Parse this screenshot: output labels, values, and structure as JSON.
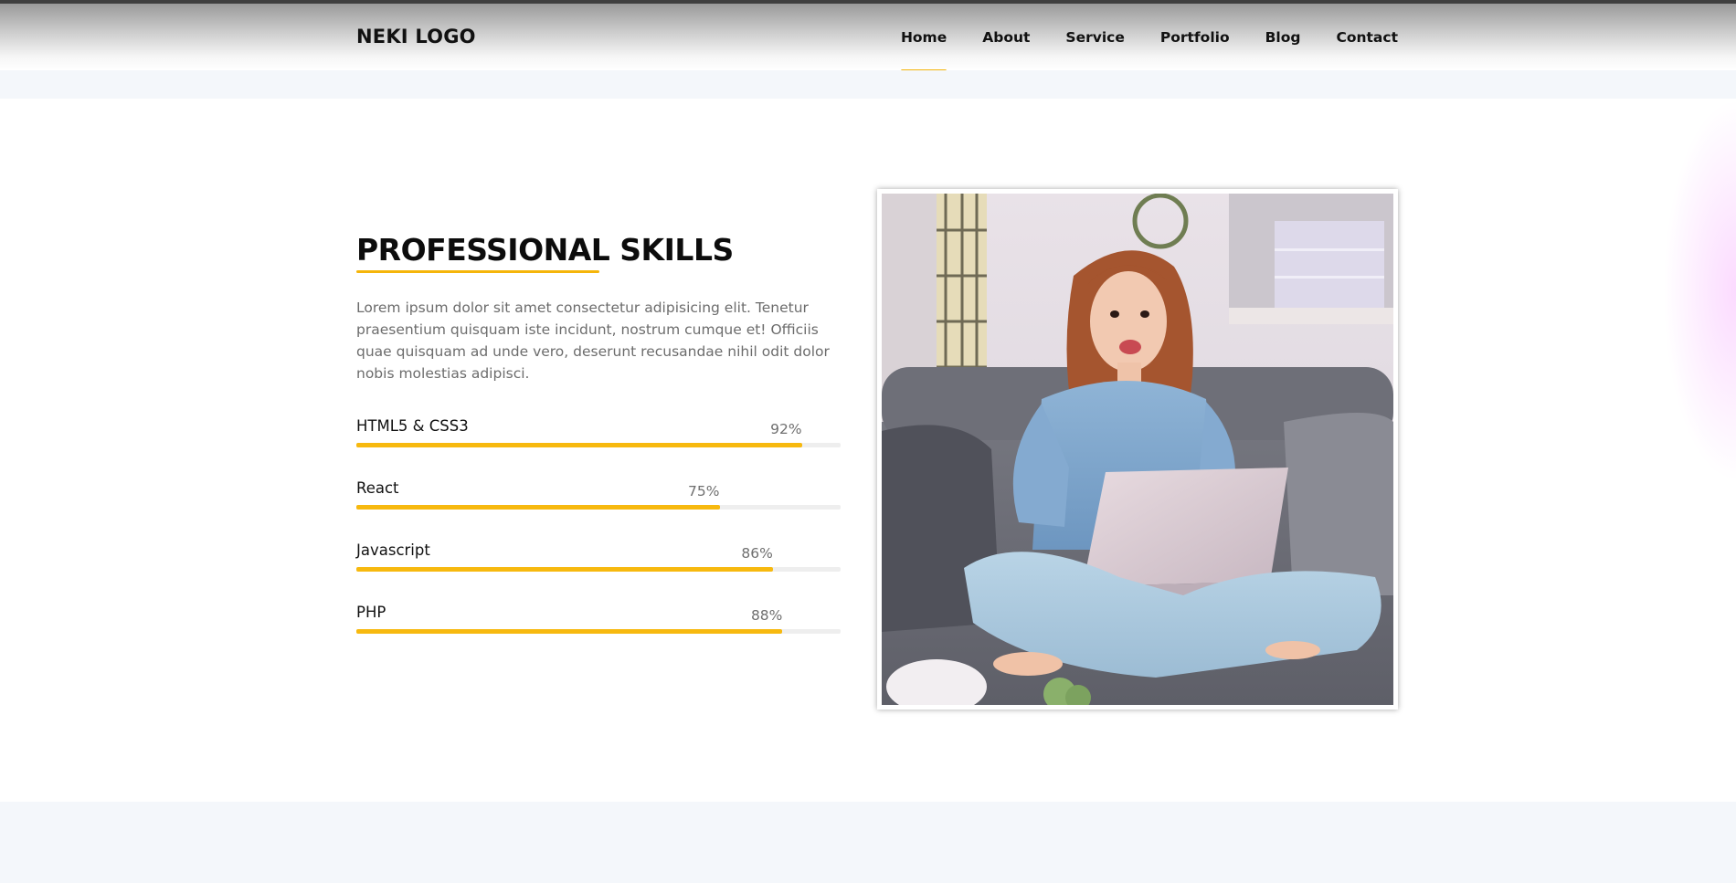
{
  "header": {
    "logo": "NEKI LOGO",
    "nav": [
      {
        "label": "Home",
        "active": true
      },
      {
        "label": "About",
        "active": false
      },
      {
        "label": "Service",
        "active": false
      },
      {
        "label": "Portfolio",
        "active": false
      },
      {
        "label": "Blog",
        "active": false
      },
      {
        "label": "Contact",
        "active": false
      }
    ]
  },
  "skills_section": {
    "title": "PROFESSIONAL SKILLS",
    "description": "Lorem ipsum dolor sit amet consectetur adipisicing elit. Tenetur praesentium quisquam iste incidunt, nostrum cumque et! Officiis quae quisquam ad unde vero, deserunt recusandae nihil odit dolor nobis molestias adipisci.",
    "skills": [
      {
        "name": "HTML5 & CSS3",
        "percent_label": "92%",
        "percent": 92
      },
      {
        "name": "React",
        "percent_label": "75%",
        "percent": 75
      },
      {
        "name": "Javascript",
        "percent_label": "86%",
        "percent": 86
      },
      {
        "name": "PHP",
        "percent_label": "88%",
        "percent": 88
      }
    ]
  },
  "colors": {
    "accent": "#f5b50a",
    "text_dark": "#111111",
    "text_muted": "#6c6c6c",
    "page_bg": "#f4f7fb"
  },
  "image": {
    "subject": "woman-with-laptop-photo"
  }
}
